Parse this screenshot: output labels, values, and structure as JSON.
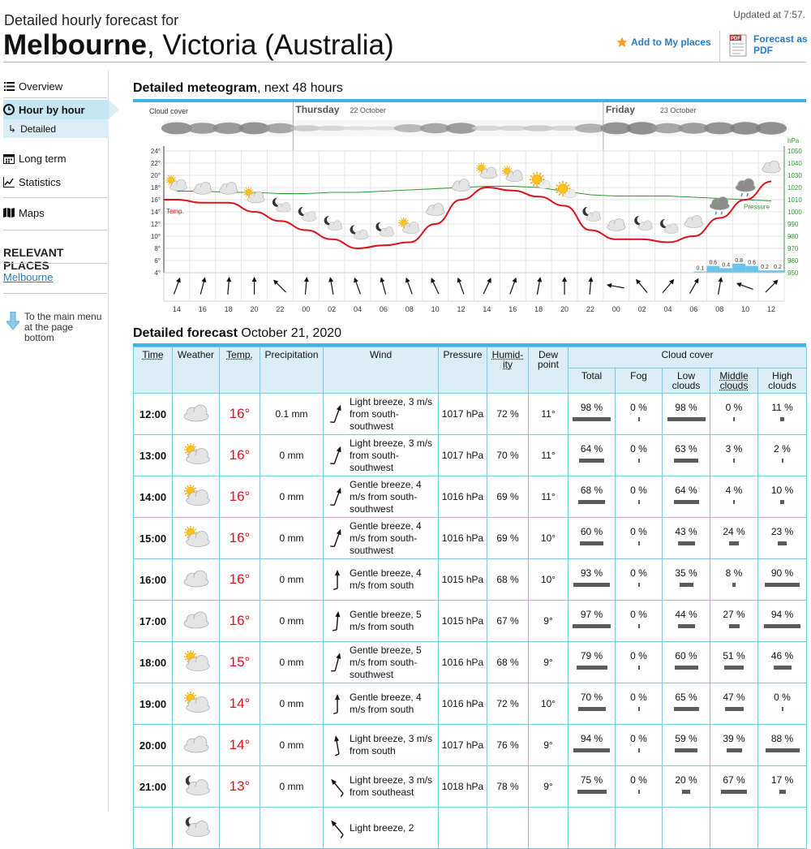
{
  "header": {
    "subtitle": "Detailed hourly forecast for",
    "city": "Melbourne",
    "region": ", Victoria (Australia)",
    "updated": "Updated at 7:57.",
    "add_places": "Add to My places",
    "pdf_link": "Forecast as PDF"
  },
  "sidebar": {
    "overview": "Overview",
    "hour_by_hour": "Hour by hour",
    "detailed": "Detailed",
    "long_term": "Long term",
    "statistics": "Statistics",
    "maps": "Maps",
    "relevant_title": "RELEVANT PLACES",
    "relevant_melbourne": "Melbourne",
    "to_main_menu": "To the main menu at the page bottom"
  },
  "meteogram": {
    "title_bold": "Detailed meteogram",
    "title_rest": ", next 48 hours",
    "cloud_cover_label": "Cloud cover",
    "days": [
      {
        "name": "Thursday",
        "date": "22 October"
      },
      {
        "name": "Friday",
        "date": "23 October"
      }
    ],
    "temp_label": "Temp.",
    "pressure_label": "Pressure",
    "pressure_unit": "hPa",
    "temp_ticks": [
      "24°",
      "22°",
      "20°",
      "18°",
      "16°",
      "14°",
      "12°",
      "10°",
      "8°",
      "6°",
      "4°"
    ],
    "pressure_ticks": [
      "1050",
      "1040",
      "1030",
      "1020",
      "1010",
      "1000",
      "990",
      "980",
      "970",
      "960",
      "950"
    ],
    "hours": [
      "14",
      "16",
      "18",
      "20",
      "22",
      "00",
      "02",
      "04",
      "06",
      "08",
      "10",
      "12",
      "14",
      "16",
      "18",
      "20",
      "22",
      "00",
      "02",
      "04",
      "06",
      "08",
      "10",
      "12"
    ],
    "precip_labels": [
      "0.1",
      "0.6",
      "0.4",
      "0.8",
      "0.6",
      "0.2",
      "0.2"
    ]
  },
  "chart_data": {
    "type": "line",
    "x": [
      "14",
      "16",
      "18",
      "20",
      "22",
      "00",
      "02",
      "04",
      "06",
      "08",
      "10",
      "12",
      "14",
      "16",
      "18",
      "20",
      "22",
      "00",
      "02",
      "04",
      "06",
      "08",
      "10",
      "12"
    ],
    "ylim": [
      4,
      24
    ],
    "y2lim": [
      950,
      1050
    ],
    "series": [
      {
        "name": "Temp.",
        "values": [
          16,
          15.5,
          15.5,
          14,
          12.5,
          11,
          9.5,
          8,
          8.5,
          9,
          12,
          16,
          18,
          17.5,
          16.5,
          15,
          11,
          9.5,
          9.5,
          9,
          10,
          13,
          16,
          19
        ]
      },
      {
        "name": "Pressure",
        "values": [
          1017,
          1017,
          1016,
          1016,
          1015,
          1015,
          1016,
          1016,
          1017,
          1018,
          1019,
          1020,
          1021,
          1021,
          1020,
          1017,
          1014,
          1013,
          1013,
          1013,
          1012,
          1011,
          1010,
          1009
        ]
      }
    ],
    "precipitation": {
      "x": [
        "06",
        "08",
        "08",
        "10",
        "10",
        "12",
        "12"
      ],
      "values": [
        0.1,
        0.6,
        0.4,
        0.8,
        0.6,
        0.2,
        0.2
      ]
    }
  },
  "forecast": {
    "title_bold": "Detailed forecast",
    "title_rest": " October 21, 2020",
    "headers": {
      "time": "Time",
      "weather": "Weather",
      "temp": "Temp.",
      "precip": "Precipitation",
      "wind": "Wind",
      "pressure": "Pressure",
      "humidity": "Humid-ity",
      "dew": "Dew point",
      "cloud": "Cloud cover",
      "total": "Total",
      "fog": "Fog",
      "low": "Low clouds",
      "middle": "Middle clouds",
      "high": "High clouds"
    },
    "rows": [
      {
        "time": "12:00",
        "icon": "cloud-icon",
        "temp": "16°",
        "precip": "0.1 mm",
        "wind_dir": 200,
        "wind": "Light breeze, 3 m/s from south-southwest",
        "pressure": "1017 hPa",
        "humidity": "72 %",
        "dew": "11°",
        "total": "98 %",
        "fog": "0 %",
        "low": "98 %",
        "mid": "0 %",
        "high": "11 %"
      },
      {
        "time": "13:00",
        "icon": "partly-cloudy-icon",
        "temp": "16°",
        "precip": "0 mm",
        "wind_dir": 200,
        "wind": "Light breeze, 3 m/s from south-southwest",
        "pressure": "1017 hPa",
        "humidity": "70 %",
        "dew": "11°",
        "total": "64 %",
        "fog": "0 %",
        "low": "63 %",
        "mid": "3 %",
        "high": "2 %"
      },
      {
        "time": "14:00",
        "icon": "partly-cloudy-icon",
        "temp": "16°",
        "precip": "0 mm",
        "wind_dir": 200,
        "wind": "Gentle breeze, 4 m/s from south-southwest",
        "pressure": "1016 hPa",
        "humidity": "69 %",
        "dew": "11°",
        "total": "68 %",
        "fog": "0 %",
        "low": "64 %",
        "mid": "4 %",
        "high": "10 %"
      },
      {
        "time": "15:00",
        "icon": "partly-cloudy-icon",
        "temp": "16°",
        "precip": "0 mm",
        "wind_dir": 200,
        "wind": "Gentle breeze, 4 m/s from south-southwest",
        "pressure": "1016 hPa",
        "humidity": "69 %",
        "dew": "10°",
        "total": "60 %",
        "fog": "0 %",
        "low": "43 %",
        "mid": "24 %",
        "high": "23 %"
      },
      {
        "time": "16:00",
        "icon": "cloud-icon",
        "temp": "16°",
        "precip": "0 mm",
        "wind_dir": 180,
        "wind": "Gentle breeze, 4 m/s from south",
        "pressure": "1015 hPa",
        "humidity": "68 %",
        "dew": "10°",
        "total": "93 %",
        "fog": "0 %",
        "low": "35 %",
        "mid": "8 %",
        "high": "90 %"
      },
      {
        "time": "17:00",
        "icon": "cloud-icon",
        "temp": "16°",
        "precip": "0 mm",
        "wind_dir": 185,
        "wind": "Gentle breeze, 5 m/s from south",
        "pressure": "1015 hPa",
        "humidity": "67 %",
        "dew": "9°",
        "total": "97 %",
        "fog": "0 %",
        "low": "44 %",
        "mid": "27 %",
        "high": "94 %"
      },
      {
        "time": "18:00",
        "icon": "partly-cloudy-icon",
        "temp": "15°",
        "precip": "0 mm",
        "wind_dir": 195,
        "wind": "Gentle breeze, 5 m/s from south-southwest",
        "pressure": "1016 hPa",
        "humidity": "68 %",
        "dew": "9°",
        "total": "79 %",
        "fog": "0 %",
        "low": "60 %",
        "mid": "51 %",
        "high": "46 %"
      },
      {
        "time": "19:00",
        "icon": "partly-cloudy-icon",
        "temp": "14°",
        "precip": "0 mm",
        "wind_dir": 180,
        "wind": "Gentle breeze, 4 m/s from south",
        "pressure": "1016 hPa",
        "humidity": "72 %",
        "dew": "10°",
        "total": "70 %",
        "fog": "0 %",
        "low": "65 %",
        "mid": "47 %",
        "high": "0 %"
      },
      {
        "time": "20:00",
        "icon": "cloud-icon",
        "temp": "14°",
        "precip": "0 mm",
        "wind_dir": 170,
        "wind": "Light breeze, 3 m/s from south",
        "pressure": "1017 hPa",
        "humidity": "76 %",
        "dew": "9°",
        "total": "94 %",
        "fog": "0 %",
        "low": "59 %",
        "mid": "39 %",
        "high": "88 %"
      },
      {
        "time": "21:00",
        "icon": "night-cloud-icon",
        "temp": "13°",
        "precip": "0 mm",
        "wind_dir": 140,
        "wind": "Light breeze, 3 m/s from southeast",
        "pressure": "1018 hPa",
        "humidity": "78 %",
        "dew": "9°",
        "total": "75 %",
        "fog": "0 %",
        "low": "20 %",
        "mid": "67 %",
        "high": "17 %"
      },
      {
        "time": "",
        "icon": "night-cloud-icon",
        "temp": "",
        "precip": "",
        "wind_dir": 140,
        "wind": "Light breeze, 2",
        "pressure": "",
        "humidity": "",
        "dew": "",
        "total": "",
        "fog": "",
        "low": "",
        "mid": "",
        "high": ""
      }
    ]
  },
  "colors": {
    "accent": "#3fb3e6",
    "temp": "#e0141b",
    "pressure": "#2e9a2e",
    "precip": "#6bc4ea",
    "link": "#2a7cc0"
  }
}
